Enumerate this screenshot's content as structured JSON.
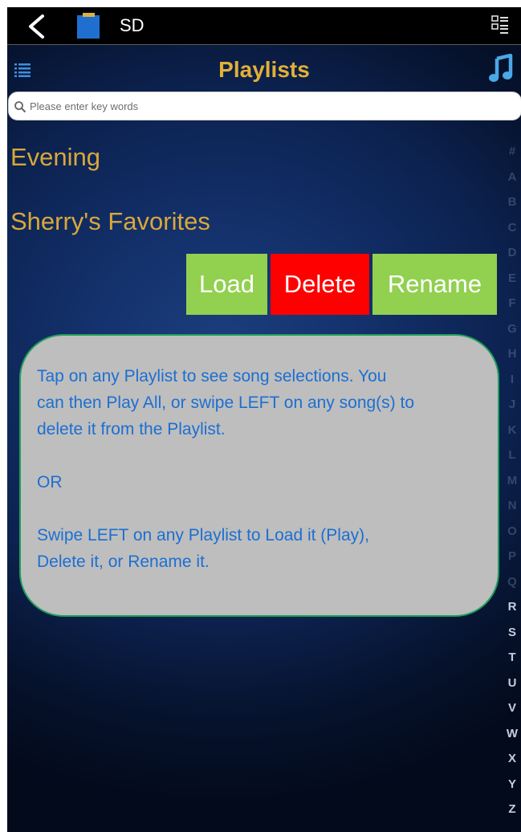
{
  "status_bar": {
    "source_label": "SD"
  },
  "header": {
    "title": "Playlists"
  },
  "search": {
    "placeholder": "Please enter key words"
  },
  "playlists": [
    {
      "name": "Evening"
    },
    {
      "name": "Sherry's Favorites"
    }
  ],
  "swipe_actions": {
    "load_label": "Load",
    "delete_label": "Delete",
    "rename_label": "Rename"
  },
  "alphabet_index": [
    "#",
    "A",
    "B",
    "C",
    "D",
    "E",
    "F",
    "G",
    "H",
    "I",
    "J",
    "K",
    "L",
    "M",
    "N",
    "O",
    "P",
    "Q",
    "R",
    "S",
    "T",
    "U",
    "V",
    "W",
    "X",
    "Y",
    "Z"
  ],
  "callout": {
    "line1": "Tap on any Playlist to see song selections.  You",
    "line2": "can then Play All, or swipe LEFT on any song(s) to",
    "line3": "delete it from the Playlist.",
    "or_text": "OR",
    "line4": "Swipe LEFT on any Playlist to Load it (Play),",
    "line5": "Delete it, or Rename it."
  },
  "colors": {
    "title_gold": "#e2b037",
    "playlist_text": "#d9a83a",
    "load_green": "#92d050",
    "delete_red": "#ff0000",
    "callout_bg": "#bebebe",
    "callout_text": "#1c6fd1",
    "callout_border": "#1ea05a",
    "music_icon": "#4aa8e8"
  }
}
